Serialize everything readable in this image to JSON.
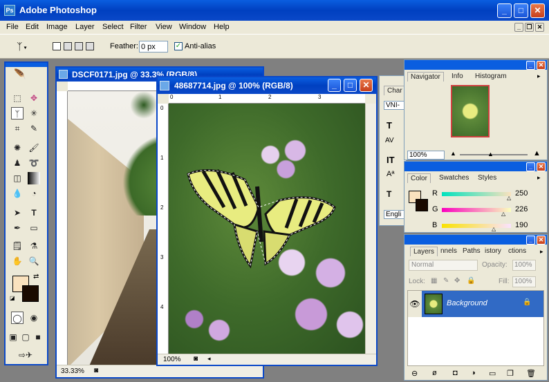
{
  "app": {
    "title": "Adobe Photoshop"
  },
  "menu": [
    "File",
    "Edit",
    "Image",
    "Layer",
    "Select",
    "Filter",
    "View",
    "Window",
    "Help"
  ],
  "options_bar": {
    "feather_label": "Feather:",
    "feather_value": "0 px",
    "antialias_label": "Anti-alias",
    "antialias_checked": true
  },
  "doc1": {
    "title": "DSCF0171.jpg @ 33.3% (RGB/8)",
    "zoom": "33.33%"
  },
  "doc2": {
    "title": "48687714.jpg @ 100% (RGB/8)",
    "zoom": "100%",
    "ruler_h": [
      "0",
      "1",
      "2",
      "3",
      "4"
    ],
    "ruler_v": [
      "0",
      "1",
      "2",
      "3",
      "4"
    ]
  },
  "char_panel": {
    "tab": "Char",
    "font": "VNI-",
    "lang": "Engli"
  },
  "navigator": {
    "tabs": [
      "Navigator",
      "Info",
      "Histogram"
    ],
    "zoom": "100%"
  },
  "color": {
    "tabs": [
      "Color",
      "Swatches",
      "Styles"
    ],
    "r_label": "R",
    "r_value": "250",
    "g_label": "G",
    "g_value": "226",
    "b_label": "B",
    "b_value": "190",
    "foreground": "#fae2be"
  },
  "layers": {
    "tabs": [
      "Layers",
      "nnels",
      "Paths",
      "istory",
      "ctions"
    ],
    "blend_mode": "Normal",
    "opacity_label": "Opacity:",
    "opacity_value": "100%",
    "lock_label": "Lock:",
    "fill_label": "Fill:",
    "fill_value": "100%",
    "layer_name": "Background"
  }
}
